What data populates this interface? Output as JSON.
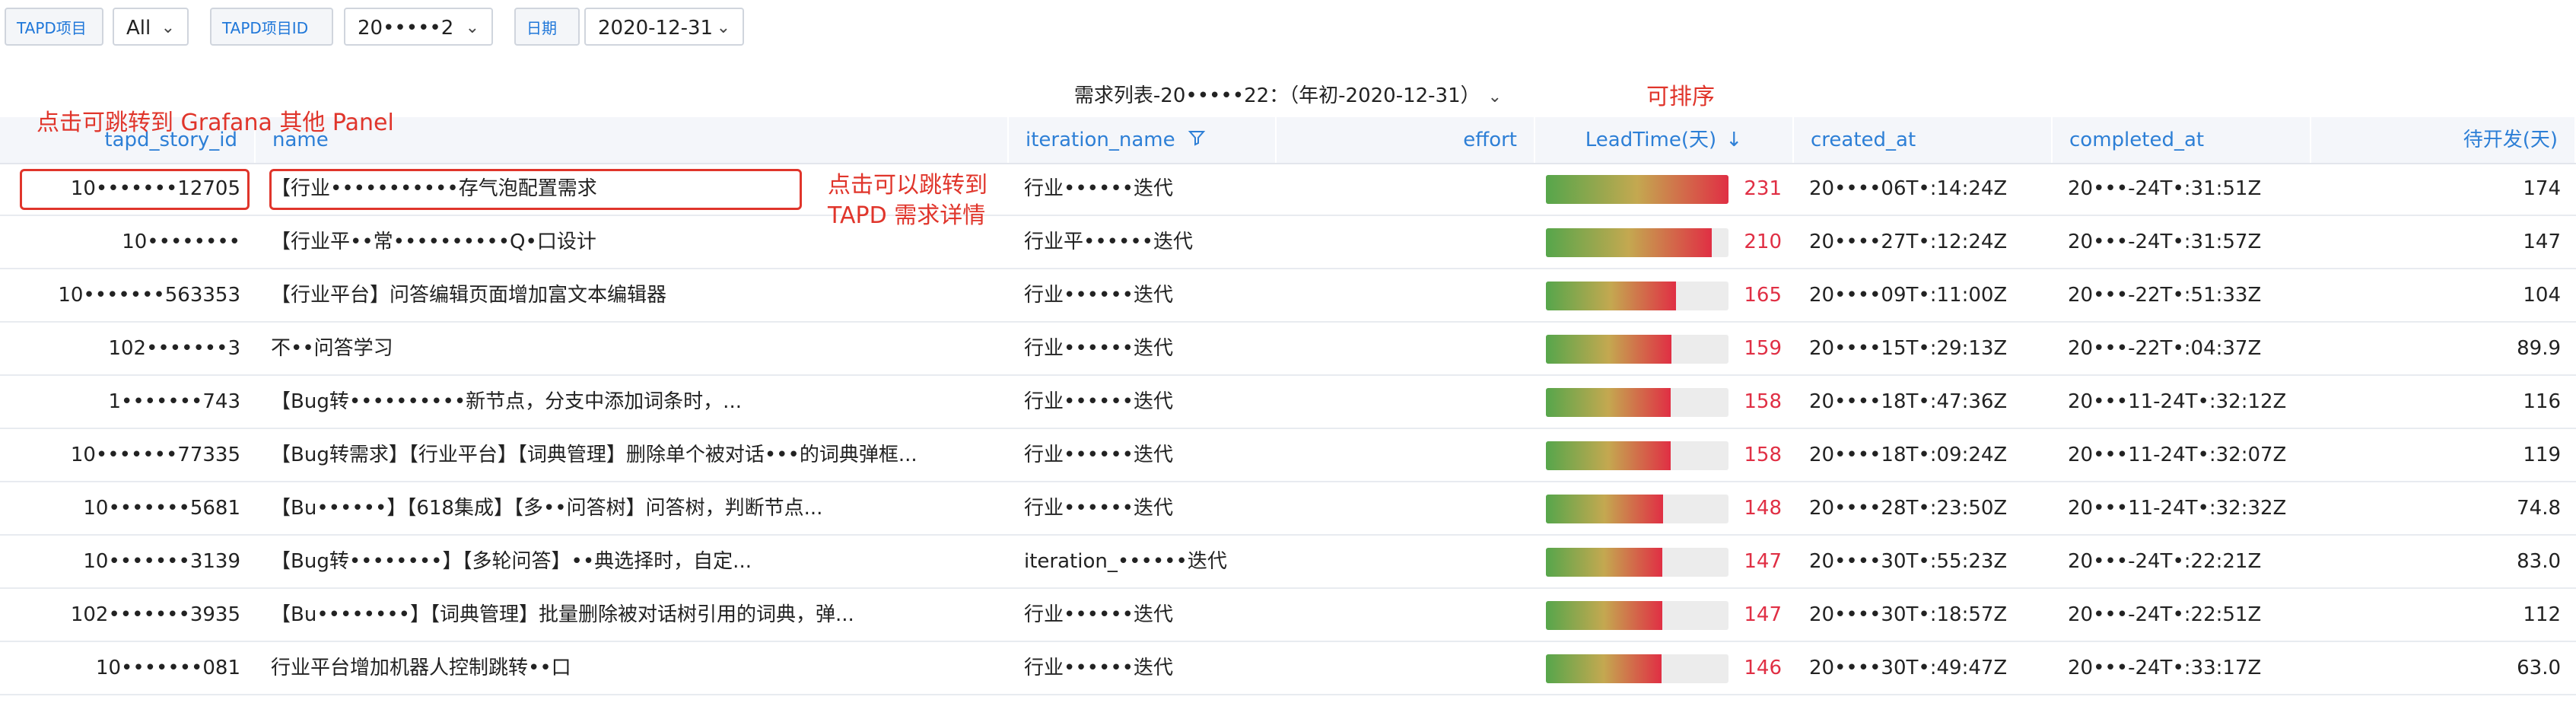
{
  "toolbar": {
    "project_label": "TAPD项目",
    "project_value": "All",
    "project_id_label": "TAPD项目ID",
    "project_id_value": "20•••••2",
    "date_label": "日期",
    "date_value": "2020-12-31"
  },
  "panel": {
    "title": "需求列表-20•••••22：（年初-2020-12-31）"
  },
  "columns": {
    "id": "tapd_story_id",
    "name": "name",
    "iteration": "iteration_name",
    "effort": "effort",
    "lead_time": "LeadTime(天)",
    "created": "created_at",
    "completed": "completed_at",
    "wait": "待开发(天)"
  },
  "annotations": {
    "grafana": "点击可跳转到 Grafana 其他 Panel",
    "tapd_line1": "点击可以跳转到",
    "tapd_line2": "TAPD 需求详情",
    "sortable": "可排序"
  },
  "leadtime_max": 231,
  "rows": [
    {
      "id": "10•••••••12705",
      "name": "【行业•••••••••••存气泡配置需求",
      "iteration": "行业••••••迭代",
      "effort": "",
      "lead_time": 231,
      "created": "20••••06T•:14:24Z",
      "completed": "20•••-24T•:31:51Z",
      "wait": "174"
    },
    {
      "id": "10••••••••",
      "name": "【行业平••常••••••••••Q•口设计",
      "iteration": "行业平••••••迭代",
      "effort": "",
      "lead_time": 210,
      "created": "20••••27T•:12:24Z",
      "completed": "20•••-24T•:31:57Z",
      "wait": "147"
    },
    {
      "id": "10•••••••563353",
      "name": "【行业平台】问答编辑页面增加富文本编辑器",
      "iteration": "行业••••••迭代",
      "effort": "",
      "lead_time": 165,
      "created": "20••••09T•:11:00Z",
      "completed": "20•••-22T•:51:33Z",
      "wait": "104"
    },
    {
      "id": "102•••••••3",
      "name": "不••问答学习",
      "iteration": "行业••••••迭代",
      "effort": "",
      "lead_time": 159,
      "created": "20••••15T•:29:13Z",
      "completed": "20•••-22T•:04:37Z",
      "wait": "89.9"
    },
    {
      "id": "1•••••••743",
      "name": "【Bug转••••••••••新节点，分支中添加词条时，...",
      "iteration": "行业••••••迭代",
      "effort": "",
      "lead_time": 158,
      "created": "20••••18T•:47:36Z",
      "completed": "20•••11-24T•:32:12Z",
      "wait": "116"
    },
    {
      "id": "10•••••••77335",
      "name": "【Bug转需求】【行业平台】【词典管理】删除单个被对话•••的词典弹框...",
      "iteration": "行业••••••迭代",
      "effort": "",
      "lead_time": 158,
      "created": "20••••18T•:09:24Z",
      "completed": "20•••11-24T•:32:07Z",
      "wait": "119"
    },
    {
      "id": "10•••••••5681",
      "name": "【Bu••••••】【618集成】【多••问答树】问答树，判断节点...",
      "iteration": "行业••••••迭代",
      "effort": "",
      "lead_time": 148,
      "created": "20••••28T•:23:50Z",
      "completed": "20•••11-24T•:32:32Z",
      "wait": "74.8"
    },
    {
      "id": "10•••••••3139",
      "name": "【Bug转••••••••】【多轮问答】••典选择时，自定...",
      "iteration": "iteration_••••••迭代",
      "effort": "",
      "lead_time": 147,
      "created": "20••••30T•:55:23Z",
      "completed": "20•••-24T•:22:21Z",
      "wait": "83.0"
    },
    {
      "id": "102•••••••3935",
      "name": "【Bu••••••••】【词典管理】批量删除被对话树引用的词典，弹...",
      "iteration": "行业••••••迭代",
      "effort": "",
      "lead_time": 147,
      "created": "20••••30T•:18:57Z",
      "completed": "20•••-24T•:22:51Z",
      "wait": "112"
    },
    {
      "id": "10•••••••081",
      "name": "行业平台增加机器人控制跳转••口",
      "iteration": "行业••••••迭代",
      "effort": "",
      "lead_time": 146,
      "created": "20••••30T•:49:47Z",
      "completed": "20•••-24T•:33:17Z",
      "wait": "63.0"
    }
  ]
}
